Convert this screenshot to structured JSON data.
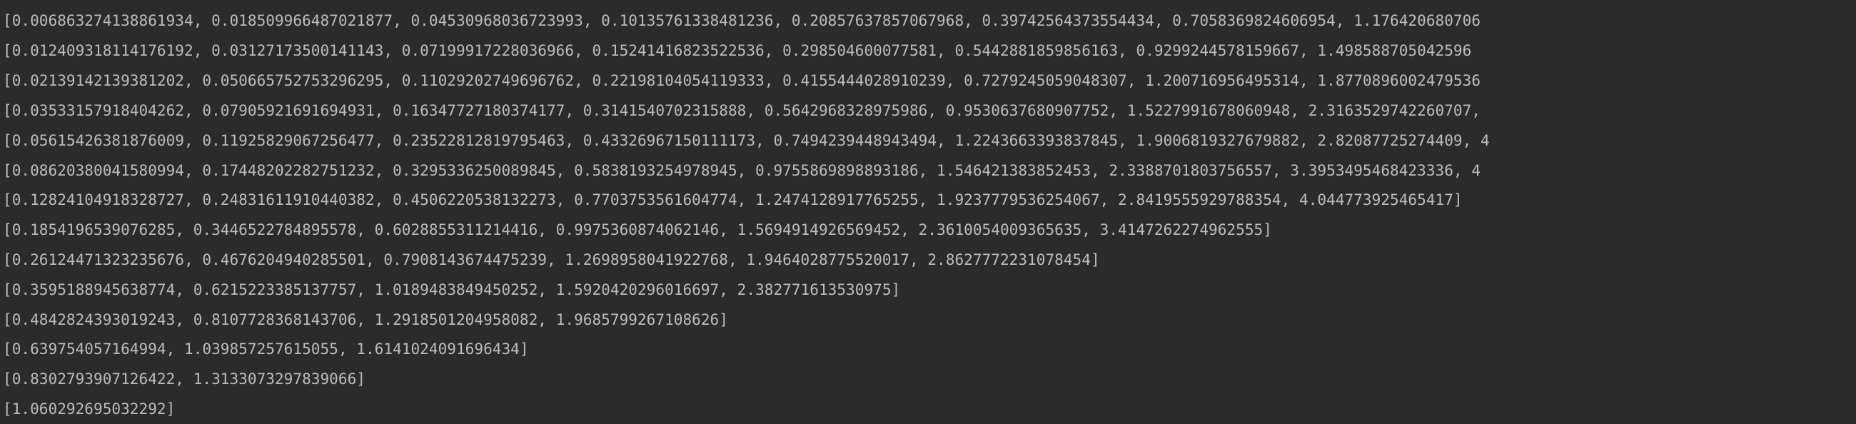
{
  "console": {
    "lines": [
      "[0.006863274138861934, 0.018509966487021877, 0.04530968036723993, 0.10135761338481236, 0.20857637857067968, 0.39742564373554434, 0.7058369824606954, 1.176420680706",
      "[0.012409318114176192, 0.03127173500141143, 0.07199917228036966, 0.15241416823522536, 0.298504600077581, 0.5442881859856163, 0.9299244578159667, 1.498588705042596",
      "[0.02139142139381202, 0.050665752753296295, 0.11029202749696762, 0.22198104054119333, 0.4155444028910239, 0.7279245059048307, 1.200716956495314, 1.8770896002479536",
      "[0.03533157918404262, 0.07905921691694931, 0.16347727180374177, 0.3141540702315888, 0.5642968328975986, 0.9530637680907752, 1.5227991678060948, 2.3163529742260707,",
      "[0.05615426381876009, 0.11925829067256477, 0.23522812819795463, 0.43326967150111173, 0.7494239448943494, 1.2243663393837845, 1.9006819327679882, 2.82087725274409, 4",
      "[0.08620380041580994, 0.17448202282751232, 0.3295336250089845, 0.5838193254978945, 0.9755869898893186, 1.546421383852453, 2.3388701803756557, 3.3953495468423336, 4",
      "[0.12824104918328727, 0.24831611910440382, 0.4506220538132273, 0.7703753561604774, 1.2474128917765255, 1.9237779536254067, 2.8419555929788354, 4.044773925465417]",
      "[0.1854196539076285, 0.3446522784895578, 0.6028855311214416, 0.9975360874062146, 1.5694914926569452, 2.3610054009365635, 3.4147262274962555]",
      "[0.26124471323235676, 0.4676204940285501, 0.7908143674475239, 1.2698958041922768, 1.9464028775520017, 2.8627772231078454]",
      "[0.3595188945638774, 0.6215223385137757, 1.0189483849450252, 1.5920420296016697, 2.382771613530975]",
      "[0.4842824393019243, 0.8107728368143706, 1.2918501204958082, 1.9685799267108626]",
      "[0.639754057164994, 1.039857257615055, 1.6141024091696434]",
      "[0.8302793907126422, 1.3133073297839066]",
      "[1.060292695032292]"
    ]
  }
}
